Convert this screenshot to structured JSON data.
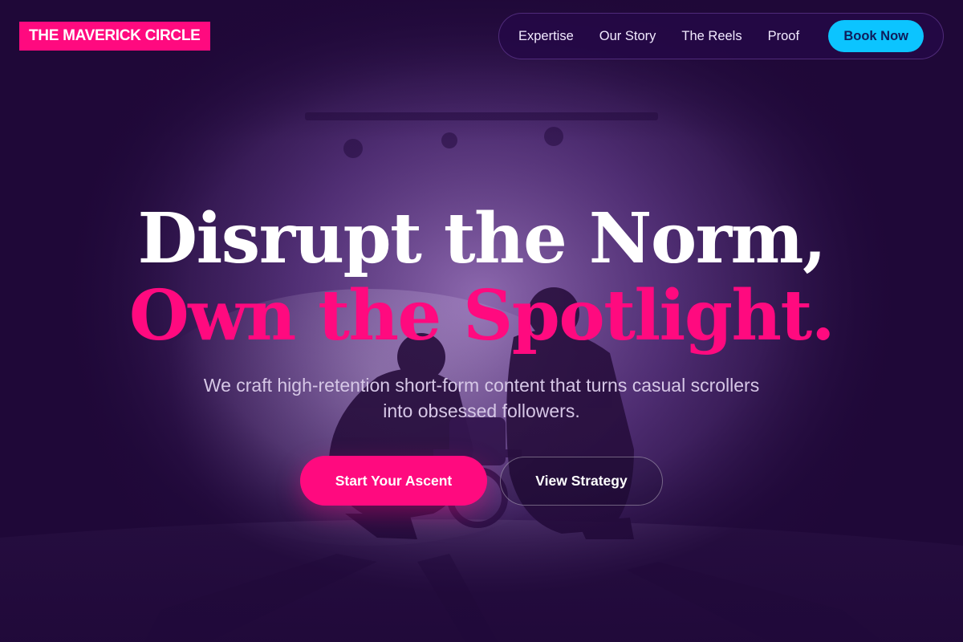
{
  "brand": {
    "logo_text": "THE MAVERICK CIRCLE"
  },
  "nav": {
    "links": [
      {
        "label": "Expertise"
      },
      {
        "label": "Our Story"
      },
      {
        "label": "The Reels"
      },
      {
        "label": "Proof"
      }
    ],
    "book_label": "Book Now"
  },
  "hero": {
    "headline_line1": "Disrupt the Norm,",
    "headline_line2": "Own the Spotlight.",
    "subtitle": "We craft high-retention short-form content that turns casual scrollers into obsessed followers.",
    "cta_primary": "Start Your Ascent",
    "cta_secondary": "View Strategy"
  },
  "colors": {
    "background": "#1f0838",
    "accent_pink": "#ff0a7f",
    "accent_cyan": "#0cc4ff",
    "text_muted": "#d6c7e6"
  },
  "background_image": {
    "icon": "film-crew-photo"
  }
}
